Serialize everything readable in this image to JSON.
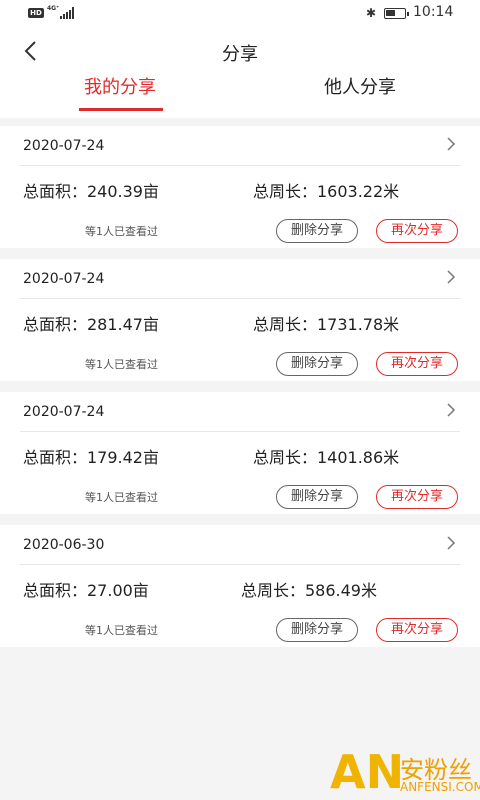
{
  "status_bar": {
    "hd_label": "HD",
    "network_label": "4G⁺",
    "time": "10:14",
    "battery_level": 0.55
  },
  "header": {
    "title": "分享",
    "tabs": [
      {
        "label": "我的分享",
        "active": true
      },
      {
        "label": "他人分享",
        "active": false
      }
    ]
  },
  "colors": {
    "accent": "#e02b2b",
    "background": "#f4f4f4"
  },
  "records": [
    {
      "date": "2020-07-24",
      "area": "总面积：240.39亩",
      "perimeter": "总周长：1603.22米",
      "viewed": "等1人已查看过",
      "delete_label": "删除分享",
      "reshare_label": "再次分享"
    },
    {
      "date": "2020-07-24",
      "area": "总面积：281.47亩",
      "perimeter": "总周长：1731.78米",
      "viewed": "等1人已查看过",
      "delete_label": "删除分享",
      "reshare_label": "再次分享"
    },
    {
      "date": "2020-07-24",
      "area": "总面积：179.42亩",
      "perimeter": "总周长：1401.86米",
      "viewed": "等1人已查看过",
      "delete_label": "删除分享",
      "reshare_label": "再次分享"
    },
    {
      "date": "2020-06-30",
      "area": "总面积：27.00亩",
      "perimeter": "总周长：586.49米",
      "viewed": "等1人已查看过",
      "delete_label": "删除分享",
      "reshare_label": "再次分享"
    }
  ],
  "watermark": {
    "logo": "AN",
    "cn": "安粉丝",
    "en": "ANFENSI.COM"
  }
}
